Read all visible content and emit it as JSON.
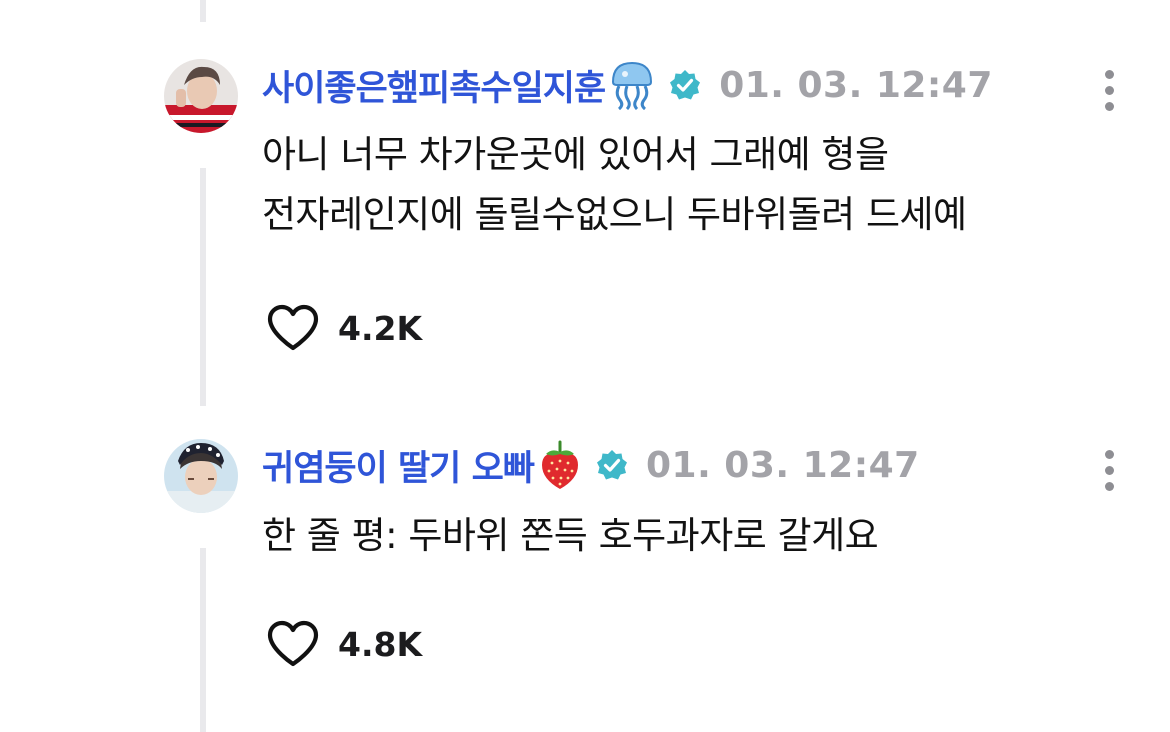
{
  "comments": [
    {
      "username": "사이좋은햎피촉수일지훈",
      "username_emoji": "jellyfish-emoji",
      "verified_icon": "verified-badge-icon",
      "timestamp": "01. 03. 12:47",
      "text_lines": [
        "아니 너무 차가운곳에 있어서 그래예 형을",
        "전자레인지에 돌릴수없으니 두바위돌려 드세예"
      ],
      "like_icon": "heart-icon",
      "likes": "4.2K",
      "more_icon": "more-vertical-icon"
    },
    {
      "username": "귀염둥이 딸기 오빠",
      "username_emoji": "strawberry-emoji",
      "verified_icon": "verified-badge-icon",
      "timestamp": "01. 03. 12:47",
      "text_lines": [
        "한 줄 평: 두바위 쫀득 호두과자로 갈게요"
      ],
      "like_icon": "heart-icon",
      "likes": "4.8K",
      "more_icon": "more-vertical-icon"
    }
  ],
  "colors": {
    "username": "#2f55d8",
    "timestamp": "#a3a3a8",
    "verified": "#3fb8c9",
    "thread_line": "#e9e9ec",
    "text": "#121212"
  }
}
